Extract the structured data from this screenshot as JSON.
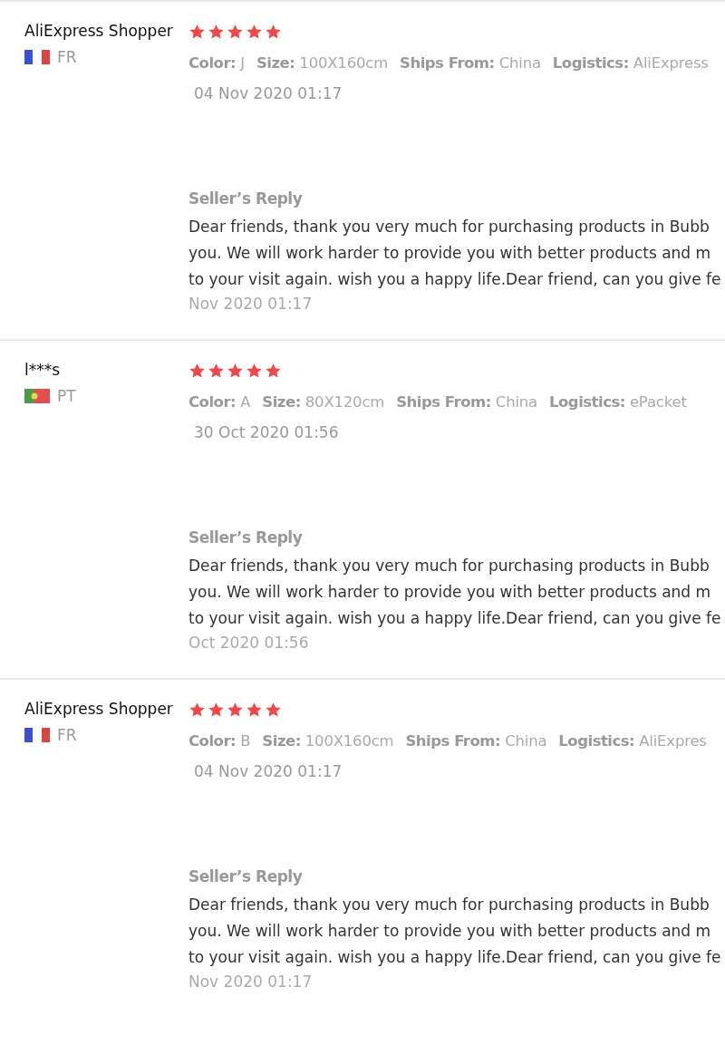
{
  "reviews": [
    {
      "name": "AliExpress Shopper",
      "flag": {
        "kind": "france"
      },
      "country": "FR",
      "stars": 5,
      "attributes": [
        {
          "label": "Color:",
          "value": "J"
        },
        {
          "label": "Size:",
          "value": "100X160cm"
        },
        {
          "label": "Ships From:",
          "value": "China"
        },
        {
          "label": "Logistics:",
          "value": "AliExpress"
        }
      ],
      "date": "04 Nov 2020 01:17",
      "reply": {
        "title": "Seller’s Reply",
        "lines": [
          "Dear friends, thank you very much for purchasing products in Bubb",
          "you. We will work harder to provide you with better products and m",
          "to your visit again. wish you a happy life.Dear friend, can you give fe"
        ],
        "date": "Nov 2020 01:17"
      }
    },
    {
      "name": "l***s",
      "flag": {
        "kind": "portugal"
      },
      "country": "PT",
      "stars": 5,
      "attributes": [
        {
          "label": "Color:",
          "value": "A"
        },
        {
          "label": "Size:",
          "value": "80X120cm"
        },
        {
          "label": "Ships From:",
          "value": "China"
        },
        {
          "label": "Logistics:",
          "value": "ePacket"
        }
      ],
      "date": "30 Oct 2020 01:56",
      "reply": {
        "title": "Seller’s Reply",
        "lines": [
          "Dear friends, thank you very much for purchasing products in Bubb",
          "you. We will work harder to provide you with better products and m",
          "to your visit again. wish you a happy life.Dear friend, can you give fe"
        ],
        "date": "Oct 2020 01:56"
      }
    },
    {
      "name": "AliExpress Shopper",
      "flag": {
        "kind": "france"
      },
      "country": "FR",
      "stars": 5,
      "attributes": [
        {
          "label": "Color:",
          "value": "B"
        },
        {
          "label": "Size:",
          "value": "100X160cm"
        },
        {
          "label": "Ships From:",
          "value": "China"
        },
        {
          "label": "Logistics:",
          "value": "AliExpres"
        }
      ],
      "date": "04 Nov 2020 01:17",
      "reply": {
        "title": "Seller’s Reply",
        "lines": [
          "Dear friends, thank you very much for purchasing products in Bubb",
          "you. We will work harder to provide you with better products and m",
          "to your visit again. wish you a happy life.Dear friend, can you give fe"
        ],
        "date": "Nov 2020 01:17"
      }
    }
  ]
}
